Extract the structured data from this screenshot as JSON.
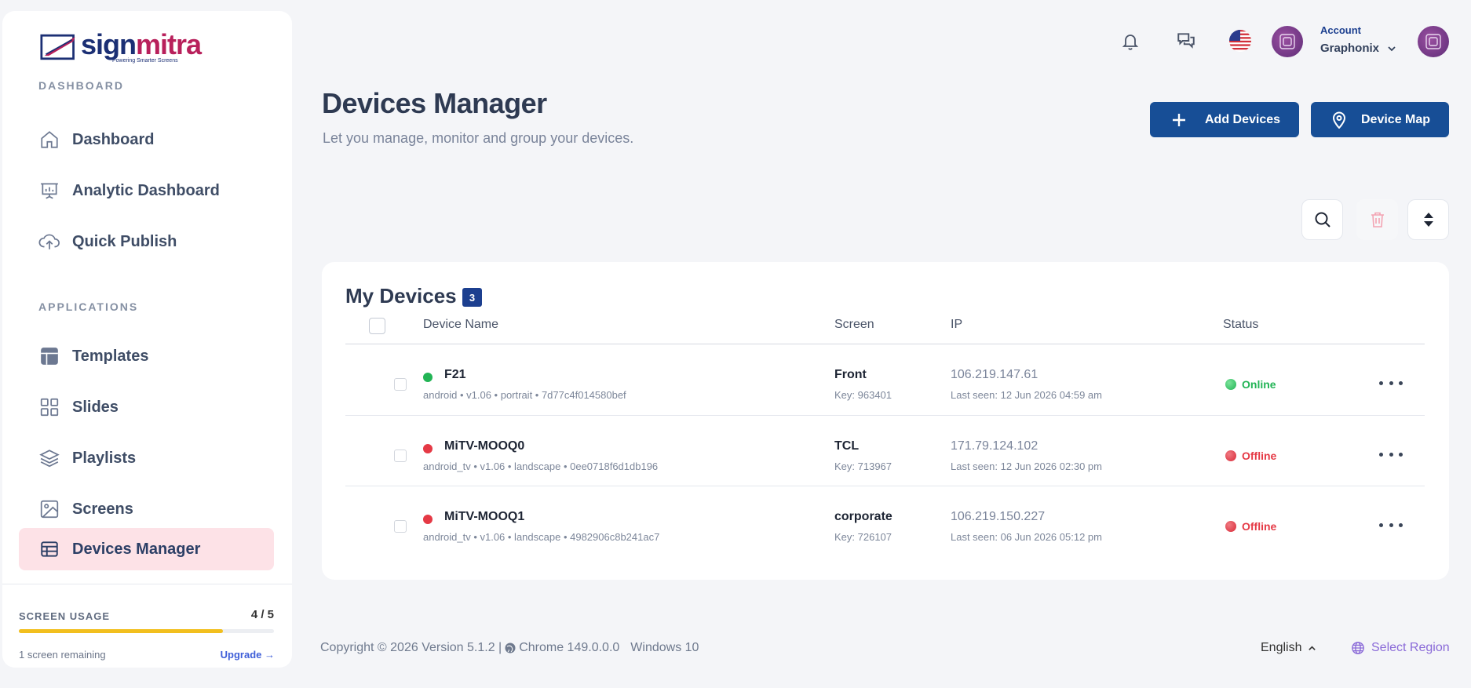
{
  "brand": {
    "name_part1": "sign",
    "name_part2": "mitra",
    "tagline": "Powering Smarter Screens",
    "primary_color": "#1b2f74",
    "accent_color": "#b8205b"
  },
  "sidebar": {
    "section_dashboard": "DASHBOARD",
    "section_applications": "APPLICATIONS",
    "items": [
      {
        "label": "Dashboard",
        "icon": "home-icon"
      },
      {
        "label": "Analytic Dashboard",
        "icon": "presentation-chart-icon"
      },
      {
        "label": "Quick Publish",
        "icon": "cloud-upload-icon"
      },
      {
        "label": "Templates",
        "icon": "template-icon"
      },
      {
        "label": "Slides",
        "icon": "grid-icon"
      },
      {
        "label": "Playlists",
        "icon": "layers-icon"
      },
      {
        "label": "Screens",
        "icon": "image-icon"
      },
      {
        "label": "Devices Manager",
        "icon": "table-icon",
        "active": true
      }
    ],
    "usage": {
      "title": "SCREEN USAGE",
      "count": "4 / 5",
      "used": 4,
      "total": 5,
      "remaining": "1 screen remaining",
      "upgrade": "Upgrade →",
      "bar_color": "#f2bf1e"
    }
  },
  "topbar": {
    "account_label": "Account",
    "account_name": "Graphonix",
    "icons": [
      "bell-icon",
      "chat-icon",
      "us-flag-icon",
      "avatar"
    ]
  },
  "header": {
    "title": "Devices Manager",
    "subtitle": "Let you manage, monitor and group your devices.",
    "add_devices": "Add Devices",
    "device_map": "Device Map",
    "button_color": "#174e96"
  },
  "toolbar": {
    "icons": [
      "search-icon",
      "trash-icon",
      "sort-icon"
    ]
  },
  "devices": {
    "title": "My Devices",
    "count": "3",
    "columns": {
      "name": "Device Name",
      "screen": "Screen",
      "ip": "IP",
      "status": "Status"
    },
    "rows": [
      {
        "name": "F21",
        "meta": "android • v1.06 • portrait • 7d77c4f014580bef",
        "screen": "Front",
        "key": "Key: 963401",
        "ip": "106.219.147.61",
        "last_seen": "Last seen: 12 Jun 2026 04:59 am",
        "status": "Online",
        "online": true
      },
      {
        "name": "MiTV-MOOQ0",
        "meta": "android_tv • v1.06 • landscape • 0ee0718f6d1db196",
        "screen": "TCL",
        "key": "Key: 713967",
        "ip": "171.79.124.102",
        "last_seen": "Last seen: 12 Jun 2026 02:30 pm",
        "status": "Offline",
        "online": false
      },
      {
        "name": "MiTV-MOOQ1",
        "meta": "android_tv • v1.06 • landscape • 4982906c8b241ac7",
        "screen": "corporate",
        "key": "Key: 726107",
        "ip": "106.219.150.227",
        "last_seen": "Last seen: 06 Jun 2026 05:12 pm",
        "status": "Offline",
        "online": false
      }
    ],
    "colors": {
      "online": "#22b455",
      "offline": "#e53945"
    }
  },
  "footer": {
    "copyright": "Copyright © 2026 Version 5.1.2 |",
    "browser": "Chrome 149.0.0.0",
    "os": "Windows 10",
    "language": "English",
    "region": "Select Region"
  }
}
